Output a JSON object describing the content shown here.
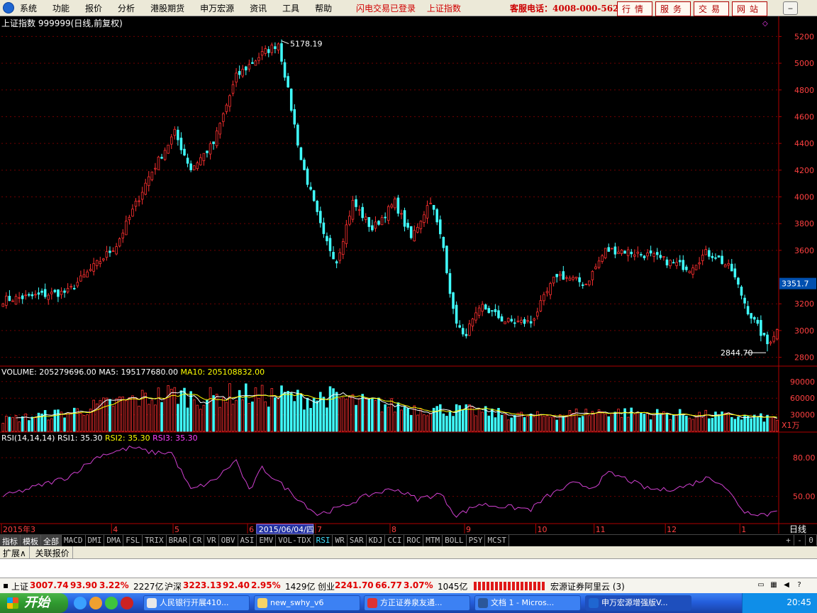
{
  "menubar": {
    "items": [
      "系统",
      "功能",
      "报价",
      "分析",
      "港股期货",
      "申万宏源",
      "资讯",
      "工具",
      "帮助"
    ],
    "status": [
      "闪电交易已登录",
      "上证指数"
    ],
    "hotline": "客服电话：4008-000-562",
    "tabs": [
      "行情",
      "服务",
      "交易",
      "网站"
    ]
  },
  "chart_data": [
    {
      "type": "candlestick",
      "title": "上证指数 999999(日线,前复权)",
      "ylim": [
        2750,
        5250
      ],
      "yticks": [
        "5200",
        "5000",
        "4800",
        "4600",
        "4400",
        "4200",
        "4000",
        "3800",
        "3600",
        "3200",
        "3000",
        "2800"
      ],
      "grid": true,
      "high_label": "5178.19",
      "low_label": "2844.70",
      "last_price": "3351.7",
      "x_ticks": [
        "2015年3",
        "4",
        "5",
        "6",
        "2015/06/04/四",
        "7",
        "8",
        "9",
        "10",
        "11",
        "12",
        "1"
      ],
      "x_tick_positions": [
        0,
        34,
        53,
        76,
        79,
        97,
        120,
        143,
        165,
        183,
        205,
        228
      ],
      "period_label": "日线",
      "n_bars": 240,
      "series": [
        {
          "name": "close",
          "keypoints": [
            [
              0,
              3230
            ],
            [
              20,
              3290
            ],
            [
              35,
              3640
            ],
            [
              45,
              4150
            ],
            [
              53,
              4480
            ],
            [
              58,
              4210
            ],
            [
              65,
              4400
            ],
            [
              72,
              4900
            ],
            [
              80,
              5070
            ],
            [
              85,
              5150
            ],
            [
              87,
              4920
            ],
            [
              92,
              4280
            ],
            [
              99,
              3700
            ],
            [
              103,
              3520
            ],
            [
              108,
              3960
            ],
            [
              114,
              3760
            ],
            [
              121,
              3960
            ],
            [
              126,
              3690
            ],
            [
              132,
              3980
            ],
            [
              136,
              3620
            ],
            [
              139,
              3140
            ],
            [
              142,
              2950
            ],
            [
              148,
              3180
            ],
            [
              155,
              3070
            ],
            [
              163,
              3060
            ],
            [
              171,
              3420
            ],
            [
              180,
              3350
            ],
            [
              186,
              3600
            ],
            [
              191,
              3600
            ],
            [
              200,
              3560
            ],
            [
              206,
              3510
            ],
            [
              212,
              3470
            ],
            [
              217,
              3580
            ],
            [
              220,
              3560
            ],
            [
              225,
              3450
            ],
            [
              230,
              3150
            ],
            [
              236,
              2900
            ],
            [
              239,
              3010
            ]
          ]
        }
      ]
    },
    {
      "type": "bar",
      "title": "VOLUME",
      "legend": [
        {
          "name": "VOLUME",
          "value": "205279696.00"
        },
        {
          "name": "MA5",
          "value": "195177680.00"
        },
        {
          "name": "MA10",
          "value": "205108832.00"
        }
      ],
      "yticks": [
        "90000",
        "60000",
        "30000"
      ],
      "unit": "X1万",
      "series": [
        {
          "name": "volume",
          "keypoints": [
            [
              0,
              20000
            ],
            [
              20,
              32000
            ],
            [
              35,
              50000
            ],
            [
              45,
              58000
            ],
            [
              53,
              65000
            ],
            [
              62,
              55000
            ],
            [
              72,
              65000
            ],
            [
              80,
              60000
            ],
            [
              87,
              62000
            ],
            [
              92,
              55000
            ],
            [
              100,
              60000
            ],
            [
              110,
              50000
            ],
            [
              126,
              40000
            ],
            [
              142,
              36000
            ],
            [
              163,
              25000
            ],
            [
              175,
              30000
            ],
            [
              186,
              34000
            ],
            [
              200,
              30000
            ],
            [
              215,
              28000
            ],
            [
              230,
              24000
            ],
            [
              239,
              22000
            ]
          ]
        }
      ]
    },
    {
      "type": "line",
      "title": "RSI(14,14,14)",
      "legend": [
        {
          "name": "RSI1",
          "value": "35.30"
        },
        {
          "name": "RSI2",
          "value": "35.30"
        },
        {
          "name": "RSI3",
          "value": "35.30"
        }
      ],
      "yticks": [
        "80.00",
        "50.00"
      ],
      "ylim": [
        30,
        90
      ],
      "series": [
        {
          "name": "RSI3",
          "keypoints": [
            [
              0,
              50
            ],
            [
              20,
              65
            ],
            [
              30,
              82
            ],
            [
              40,
              88
            ],
            [
              46,
              84
            ],
            [
              52,
              84
            ],
            [
              58,
              55
            ],
            [
              65,
              62
            ],
            [
              72,
              78
            ],
            [
              76,
              54
            ],
            [
              80,
              72
            ],
            [
              88,
              55
            ],
            [
              97,
              36
            ],
            [
              105,
              42
            ],
            [
              110,
              48
            ],
            [
              114,
              52
            ],
            [
              121,
              56
            ],
            [
              128,
              48
            ],
            [
              135,
              52
            ],
            [
              140,
              35
            ],
            [
              147,
              44
            ],
            [
              155,
              42
            ],
            [
              163,
              40
            ],
            [
              168,
              50
            ],
            [
              172,
              55
            ],
            [
              176,
              60
            ],
            [
              182,
              57
            ],
            [
              187,
              68
            ],
            [
              192,
              64
            ],
            [
              199,
              56
            ],
            [
              204,
              55
            ],
            [
              211,
              58
            ],
            [
              218,
              65
            ],
            [
              222,
              60
            ],
            [
              229,
              38
            ],
            [
              236,
              36
            ],
            [
              239,
              40
            ]
          ]
        }
      ]
    }
  ],
  "indicators": {
    "tabs": [
      "指标",
      "模板",
      "全部"
    ],
    "items": [
      "MACD",
      "DMI",
      "DMA",
      "FSL",
      "TRIX",
      "BRAR",
      "CR",
      "VR",
      "OBV",
      "ASI",
      "EMV",
      "VOL-TDX",
      "RSI",
      "WR",
      "SAR",
      "KDJ",
      "CCI",
      "ROC",
      "MTM",
      "BOLL",
      "PSY",
      "MCST"
    ],
    "selected": "RSI",
    "tools": [
      "+",
      "-",
      "0"
    ]
  },
  "extbar": {
    "items": [
      "扩展∧",
      "关联报价"
    ]
  },
  "quote": {
    "sh": {
      "name": "上证",
      "price": "3007.74",
      "change": "93.90",
      "pct": "3.22%",
      "amount": "2227亿"
    },
    "hs": {
      "name": "沪深",
      "price": "3223.13",
      "change": "92.40",
      "pct": "2.95%",
      "amount": "1429亿"
    },
    "cy": {
      "name": "创业",
      "price": "2241.70",
      "change": "66.77",
      "pct": "3.07%",
      "amount": "1045亿"
    },
    "broker": "宏源证券阿里云 (3)"
  },
  "taskbar": {
    "start": "开始",
    "tasks": [
      "人民银行开展410...",
      "new_swhy_v6",
      "方正证券泉友通...",
      "文档 1 - Micros...",
      "申万宏源增强版V..."
    ],
    "active_task": 4,
    "clock": "20:45"
  },
  "colors": {
    "up": "#ff3030",
    "down": "#40ffff",
    "ma5": "#ffffff",
    "ma10": "#ffff00",
    "rsi": "#d040d0",
    "axis": "#b00000"
  }
}
